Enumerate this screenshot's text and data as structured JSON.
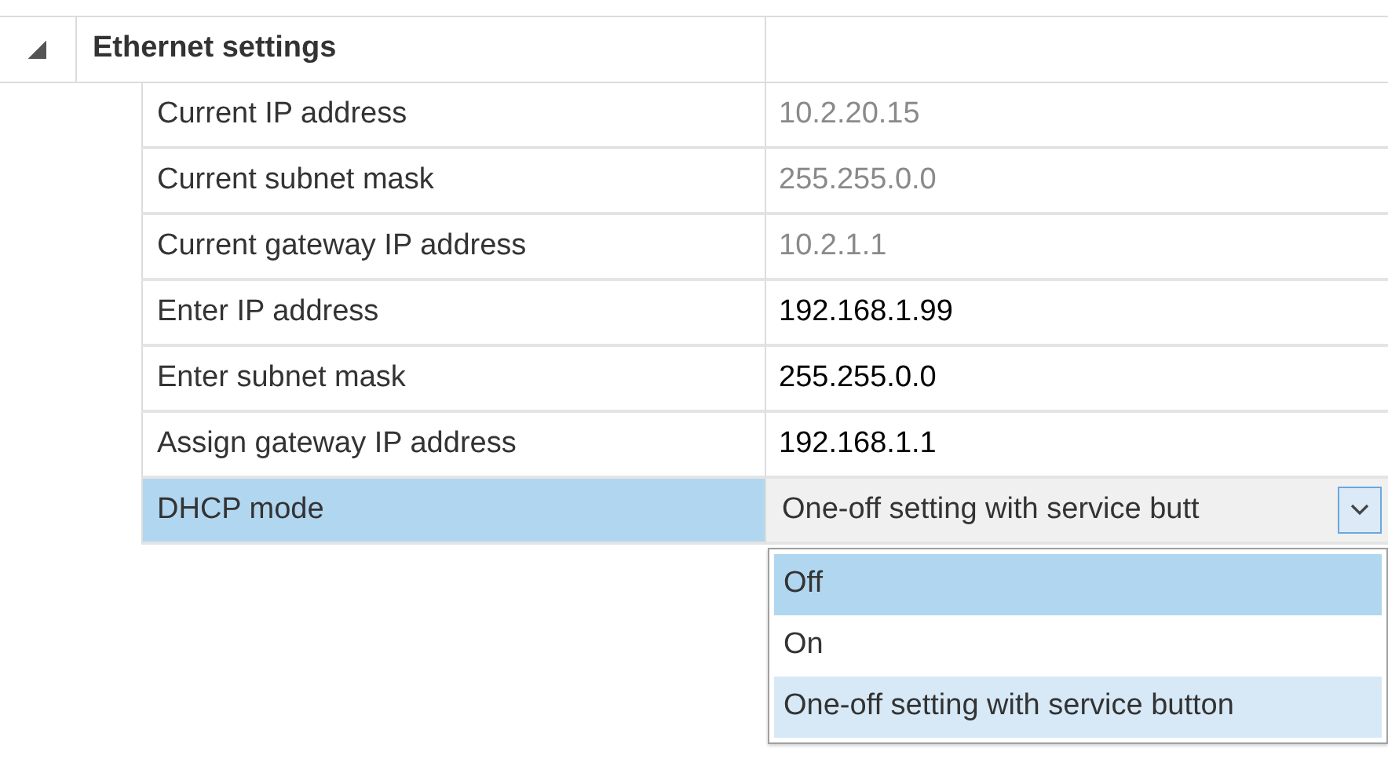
{
  "group": {
    "title": "Ethernet settings",
    "expanded": true
  },
  "properties": [
    {
      "label": "Current IP address",
      "value": "10.2.20.15",
      "kind": "text",
      "editable": false,
      "selected": false
    },
    {
      "label": "Current subnet mask",
      "value": "255.255.0.0",
      "kind": "text",
      "editable": false,
      "selected": false
    },
    {
      "label": "Current gateway IP address",
      "value": "10.2.1.1",
      "kind": "text",
      "editable": false,
      "selected": false
    },
    {
      "label": "Enter IP address",
      "value": "192.168.1.99",
      "kind": "text",
      "editable": true,
      "selected": false
    },
    {
      "label": "Enter subnet mask",
      "value": "255.255.0.0",
      "kind": "text",
      "editable": true,
      "selected": false
    },
    {
      "label": "Assign gateway IP address",
      "value": "192.168.1.1",
      "kind": "text",
      "editable": true,
      "selected": false
    },
    {
      "label": "DHCP mode",
      "value": "One-off setting with service butt",
      "kind": "dropdown",
      "editable": true,
      "selected": true
    }
  ],
  "dropdown_options": [
    {
      "label": "Off",
      "selected": true,
      "hovered": false
    },
    {
      "label": "On",
      "selected": false,
      "hovered": false
    },
    {
      "label": "One-off setting with service button",
      "selected": false,
      "hovered": true
    }
  ]
}
